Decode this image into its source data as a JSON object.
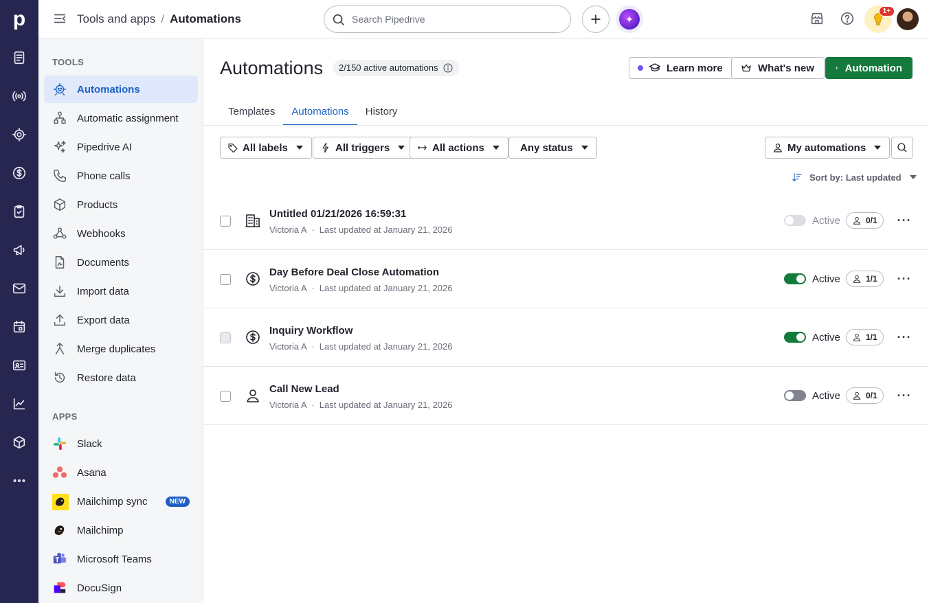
{
  "rail": {
    "logo": "p"
  },
  "topbar": {
    "breadcrumb": {
      "parent": "Tools and apps",
      "separator": "/",
      "current": "Automations"
    },
    "search_placeholder": "Search Pipedrive",
    "notification_badge": "1+"
  },
  "sidebar": {
    "tools_title": "TOOLS",
    "tools": [
      {
        "label": "Automations",
        "icon": "automation-robot-icon"
      },
      {
        "label": "Automatic assignment",
        "icon": "assignment-icon"
      },
      {
        "label": "Pipedrive AI",
        "icon": "sparkles-icon"
      },
      {
        "label": "Phone calls",
        "icon": "phone-icon"
      },
      {
        "label": "Products",
        "icon": "box-icon"
      },
      {
        "label": "Webhooks",
        "icon": "webhook-icon"
      },
      {
        "label": "Documents",
        "icon": "document-icon"
      },
      {
        "label": "Import data",
        "icon": "import-icon"
      },
      {
        "label": "Export data",
        "icon": "export-icon"
      },
      {
        "label": "Merge duplicates",
        "icon": "merge-icon"
      },
      {
        "label": "Restore data",
        "icon": "restore-icon"
      }
    ],
    "apps_title": "APPS",
    "apps": [
      {
        "label": "Slack"
      },
      {
        "label": "Asana"
      },
      {
        "label": "Mailchimp sync",
        "badge": "NEW"
      },
      {
        "label": "Mailchimp"
      },
      {
        "label": "Microsoft Teams"
      },
      {
        "label": "DocuSign"
      }
    ]
  },
  "main": {
    "title": "Automations",
    "active_count": "2/150 active automations",
    "buttons": {
      "learn_more": "Learn more",
      "whats_new": "What's new",
      "add": "Automation"
    },
    "tabs": [
      "Templates",
      "Automations",
      "History"
    ],
    "filters": {
      "labels": "All labels",
      "triggers": "All triggers",
      "actions": "All actions",
      "status": "Any status",
      "owner": "My automations"
    },
    "sort_label": "Sort by: Last updated",
    "rows": [
      {
        "name": "Untitled 01/21/2026 16:59:31",
        "owner": "Victoria A",
        "dot": "·",
        "updated": "Last updated at January 21, 2026",
        "status": "Active",
        "owners": "0/1",
        "icon": "building-icon",
        "toggle": "disabled"
      },
      {
        "name": "Day Before Deal Close Automation",
        "owner": "Victoria A",
        "dot": "·",
        "updated": "Last updated at January 21, 2026",
        "status": "Active",
        "owners": "1/1",
        "icon": "dollar-icon",
        "toggle": "on"
      },
      {
        "name": "Inquiry Workflow",
        "owner": "Victoria A",
        "dot": "·",
        "updated": "Last updated at January 21, 2026",
        "status": "Active",
        "owners": "1/1",
        "icon": "dollar-icon",
        "toggle": "on"
      },
      {
        "name": "Call New Lead",
        "owner": "Victoria A",
        "dot": "·",
        "updated": "Last updated at January 21, 2026",
        "status": "Active",
        "owners": "0/1",
        "icon": "person-icon",
        "toggle": "off"
      }
    ]
  },
  "colors": {
    "rail": "#262650",
    "accent": "#1d60c4",
    "primary_button": "#137a3c",
    "active_nav_bg": "#dfe9fb"
  }
}
